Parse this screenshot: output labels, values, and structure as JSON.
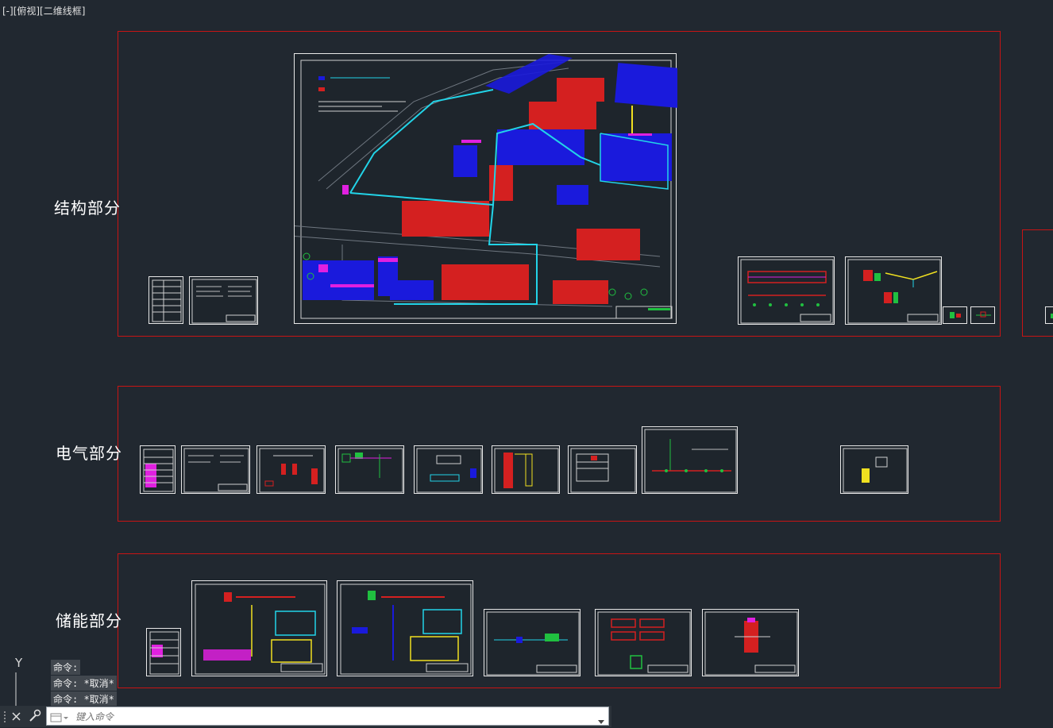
{
  "viewport": {
    "label": "[-][俯视][二维线框]"
  },
  "groups": [
    {
      "label": "结构部分"
    },
    {
      "label": "电气部分"
    },
    {
      "label": "储能部分"
    }
  ],
  "ucs": {
    "axis_label": "Y"
  },
  "command_line": {
    "history": [
      "命令:",
      "命令: *取消*",
      "命令: *取消*"
    ],
    "placeholder": "键入命令"
  },
  "colors": {
    "background": "#212830",
    "frame": "#c81414",
    "sheet_border": "#e8e8e8",
    "blue": "#1a1adc",
    "red": "#d42020",
    "cyan": "#22d4e8",
    "magenta": "#e020e0",
    "yellow": "#f0e020",
    "green": "#20c040"
  }
}
